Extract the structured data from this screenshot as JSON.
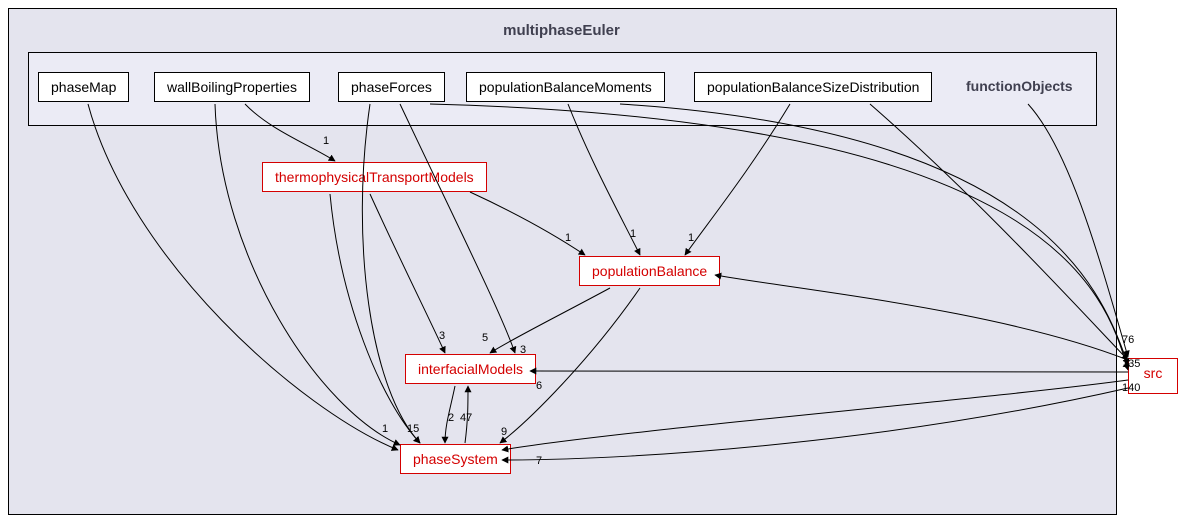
{
  "title": "multiphaseEuler",
  "sectionLabel": "functionObjects",
  "topNodes": {
    "phaseMap": "phaseMap",
    "wallBoilingProperties": "wallBoilingProperties",
    "phaseForces": "phaseForces",
    "populationBalanceMoments": "populationBalanceMoments",
    "populationBalanceSizeDistribution": "populationBalanceSizeDistribution"
  },
  "midNodes": {
    "thermophysicalTransportModels": "thermophysicalTransportModels",
    "populationBalance": "populationBalance",
    "interfacialModels": "interfacialModels",
    "phaseSystem": "phaseSystem"
  },
  "extNode": "src",
  "edgeWeights": {
    "w1a": "1",
    "w1b": "1",
    "w1c": "1",
    "w1d": "1",
    "w1e": "1",
    "w3a": "3",
    "w5": "5",
    "w3b": "3",
    "w6": "6",
    "w15": "15",
    "w2": "2",
    "w47": "47",
    "w9": "9",
    "w7_right": "76",
    "w135": "135",
    "w140": "140",
    "w7": "7"
  },
  "chart_data": {
    "type": "graph",
    "directed": true,
    "nodes": [
      {
        "id": "phaseMap",
        "label": "phaseMap",
        "group": "top"
      },
      {
        "id": "wallBoilingProperties",
        "label": "wallBoilingProperties",
        "group": "top"
      },
      {
        "id": "phaseForces",
        "label": "phaseForces",
        "group": "top"
      },
      {
        "id": "populationBalanceMoments",
        "label": "populationBalanceMoments",
        "group": "top"
      },
      {
        "id": "populationBalanceSizeDistribution",
        "label": "populationBalanceSizeDistribution",
        "group": "top"
      },
      {
        "id": "functionObjects",
        "label": "functionObjects",
        "group": "section"
      },
      {
        "id": "thermophysicalTransportModels",
        "label": "thermophysicalTransportModels",
        "group": "mid"
      },
      {
        "id": "populationBalance",
        "label": "populationBalance",
        "group": "mid"
      },
      {
        "id": "interfacialModels",
        "label": "interfacialModels",
        "group": "mid"
      },
      {
        "id": "phaseSystem",
        "label": "phaseSystem",
        "group": "mid"
      },
      {
        "id": "src",
        "label": "src",
        "group": "ext"
      }
    ],
    "edges": [
      {
        "from": "wallBoilingProperties",
        "to": "thermophysicalTransportModels",
        "weight": 1
      },
      {
        "from": "thermophysicalTransportModels",
        "to": "populationBalance",
        "weight": 1
      },
      {
        "from": "populationBalanceMoments",
        "to": "populationBalance",
        "weight": 1
      },
      {
        "from": "populationBalanceSizeDistribution",
        "to": "populationBalance",
        "weight": 1
      },
      {
        "from": "thermophysicalTransportModels",
        "to": "interfacialModels",
        "weight": 3
      },
      {
        "from": "populationBalance",
        "to": "interfacialModels",
        "weight": 5
      },
      {
        "from": "phaseForces",
        "to": "interfacialModels",
        "weight": 3
      },
      {
        "from": "phaseMap",
        "to": "phaseSystem",
        "weight": 1
      },
      {
        "from": "wallBoilingProperties",
        "to": "phaseSystem",
        "weight": null
      },
      {
        "from": "phaseForces",
        "to": "phaseSystem",
        "weight": null
      },
      {
        "from": "thermophysicalTransportModels",
        "to": "phaseSystem",
        "weight": 15
      },
      {
        "from": "interfacialModels",
        "to": "phaseSystem",
        "weight": 47
      },
      {
        "from": "phaseSystem",
        "to": "interfacialModels",
        "weight": 2
      },
      {
        "from": "populationBalance",
        "to": "phaseSystem",
        "weight": 9
      },
      {
        "from": "src",
        "to": "interfacialModels",
        "weight": 6
      },
      {
        "from": "functionObjects",
        "to": "src",
        "weight": null
      },
      {
        "from": "src",
        "to": "populationBalance",
        "weight": 76
      },
      {
        "from": "src",
        "to": "interfacialModels",
        "weight": 135
      },
      {
        "from": "src",
        "to": "phaseSystem",
        "weight": 140
      },
      {
        "from": "src",
        "to": "phaseSystem",
        "weight": 7
      },
      {
        "from": "populationBalanceSizeDistribution",
        "to": "src",
        "weight": null
      },
      {
        "from": "populationBalanceMoments",
        "to": "src",
        "weight": null
      },
      {
        "from": "phaseForces",
        "to": "src",
        "weight": null
      }
    ]
  }
}
